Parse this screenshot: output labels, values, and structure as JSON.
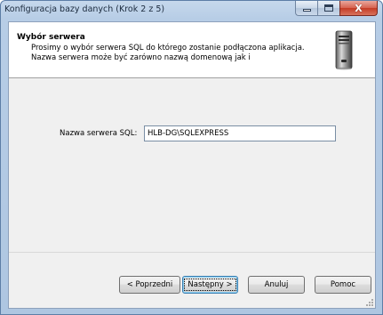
{
  "window": {
    "title": "Konfiguracja bazy danych (Krok 2 z 5)",
    "caption_buttons": {
      "minimize_icon": "minimize-icon",
      "maximize_icon": "maximize-icon",
      "close_icon": "close-icon",
      "close_glyph": "X"
    }
  },
  "header": {
    "title": "Wybór serwera",
    "description": "Prosimy o wybór serwera SQL do którego zostanie podłączona aplikacja. Nazwa serwera może być zarówno nazwą domenową jak i",
    "icon": "server-tower-icon"
  },
  "form": {
    "server_label": "Nazwa serwera SQL:",
    "server_value": "HLB-DG\\SQLEXPRESS"
  },
  "buttons": {
    "back": "< Poprzedni",
    "next": "Następny >",
    "cancel": "Anuluj",
    "help": "Pomoc"
  },
  "colors": {
    "title_bar": "#b7cde6",
    "close_button": "#c43c25",
    "dialog_body": "#f0f0f0",
    "header_bg": "#ffffff",
    "default_button_border": "#3c7fb1"
  }
}
